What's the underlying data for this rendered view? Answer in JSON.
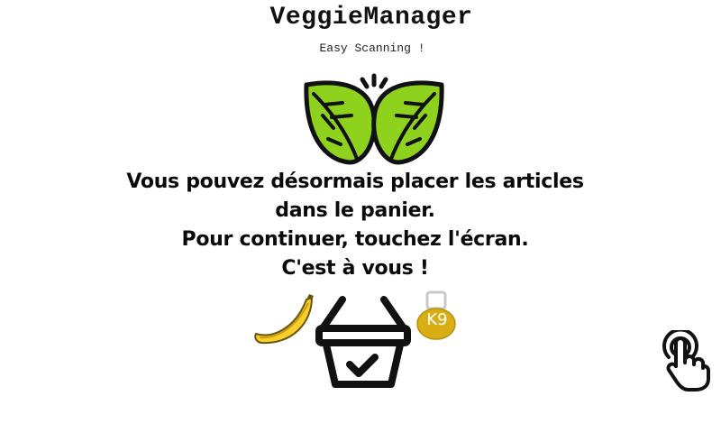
{
  "header": {
    "title": "VeggieManager",
    "subtitle": "Easy Scanning !"
  },
  "message": {
    "lines": [
      "Vous pouvez désormais placer les articles",
      "dans le panier.",
      "Pour continuer, touchez l'écran.",
      "C'est à vous !"
    ]
  },
  "illustrations": {
    "logo_icon": "leaves-icon",
    "banana_icon": "banana-icon",
    "basket_icon": "basket-check-icon",
    "weight_icon": "weight-icon",
    "weight_label": "K9",
    "touch_icon": "touch-hand-icon"
  },
  "colors": {
    "leaf_green": "#8fd21e",
    "banana_yellow": "#f7cf2a",
    "weight_gold": "#d9ad14",
    "outline": "#111111"
  }
}
